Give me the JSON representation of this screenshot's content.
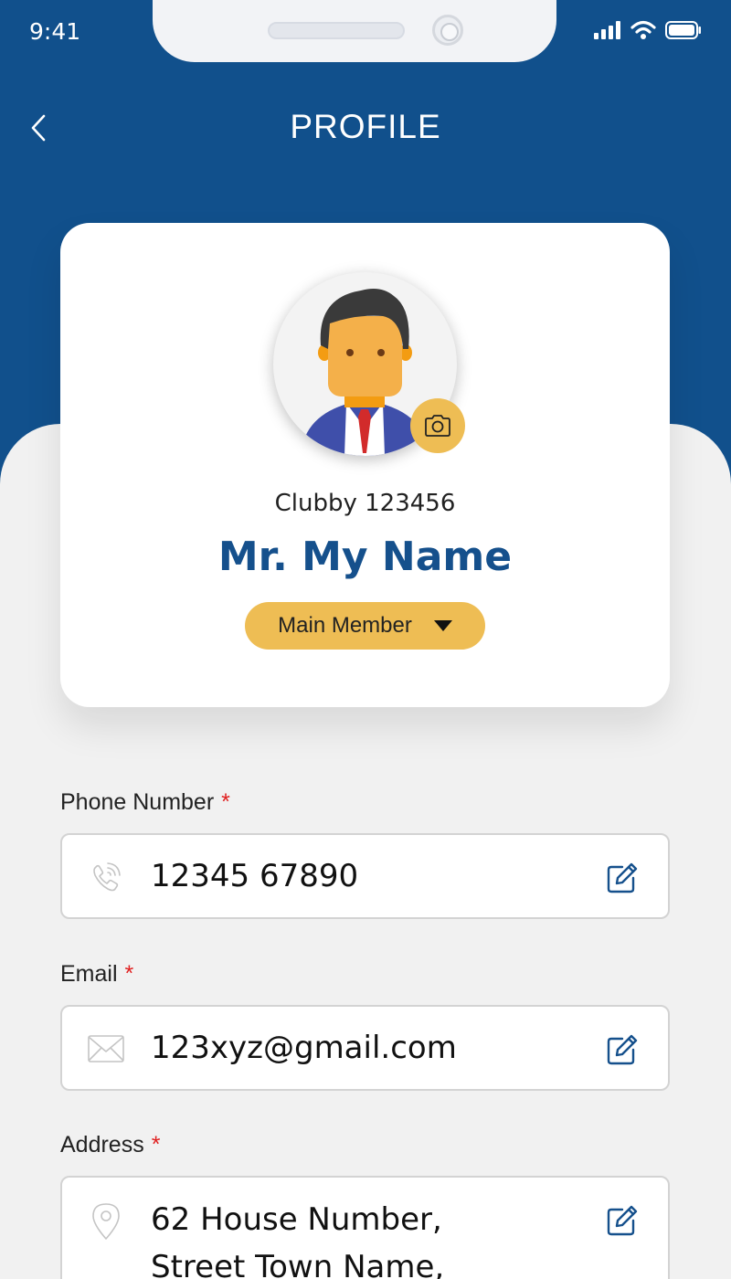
{
  "status_bar": {
    "time": "9:41",
    "icons": [
      "signal-icon",
      "wifi-icon",
      "battery-icon"
    ]
  },
  "header": {
    "title": "PROFILE",
    "back_icon": "chevron-left-icon"
  },
  "profile": {
    "member_id": "Clubby 123456",
    "name": "Mr. My Name",
    "member_type": "Main Member",
    "avatar_icon": "user-avatar",
    "camera_icon": "camera-icon"
  },
  "fields": {
    "phone": {
      "label": "Phone Number",
      "required": "*",
      "value": "12345 67890",
      "icon": "phone-icon",
      "edit_icon": "edit-icon"
    },
    "email": {
      "label": "Email",
      "required": "*",
      "value": "123xyz@gmail.com",
      "icon": "mail-icon",
      "edit_icon": "edit-icon"
    },
    "address": {
      "label": "Address",
      "required": "*",
      "value_line1": "62 House Number,",
      "value_line2": "Street Town Name,",
      "icon": "location-pin-icon",
      "edit_icon": "edit-icon"
    }
  },
  "colors": {
    "primary": "#11508c",
    "accent": "#eebd54",
    "background": "#f1f1f1",
    "required": "#e02020"
  }
}
